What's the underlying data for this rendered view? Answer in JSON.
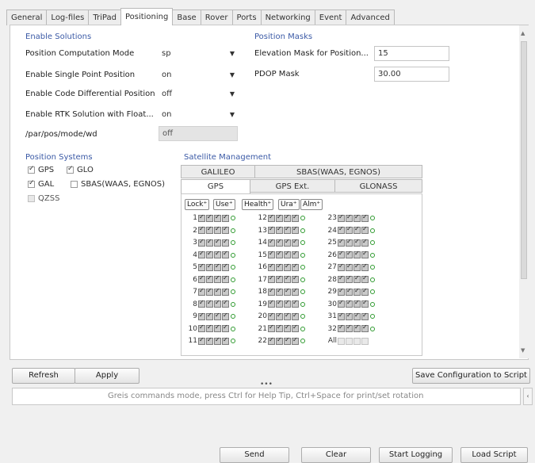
{
  "tabs": [
    "General",
    "Log-files",
    "TriPad",
    "Positioning",
    "Base",
    "Rover",
    "Ports",
    "Networking",
    "Event",
    "Advanced"
  ],
  "active_tab": "Positioning",
  "enable_solutions": {
    "title": "Enable Solutions",
    "rows": [
      {
        "label": "Position Computation Mode",
        "value": "sp"
      },
      {
        "label": "Enable Single Point Position",
        "value": "on"
      },
      {
        "label": "Enable Code Differential Position",
        "value": "off"
      },
      {
        "label": "Enable RTK Solution with Float...",
        "value": "on"
      }
    ],
    "wd_label": "/par/pos/mode/wd",
    "wd_value": "off"
  },
  "position_masks": {
    "title": "Position Masks",
    "elev_label": "Elevation Mask for Position...",
    "elev_value": "15",
    "pdop_label": "PDOP Mask",
    "pdop_value": "30.00"
  },
  "position_systems": {
    "title": "Position Systems",
    "gps": "GPS",
    "glo": "GLO",
    "gal": "GAL",
    "sbas": "SBAS(WAAS, EGNOS)",
    "qzss": "QZSS"
  },
  "sat_mgmt": {
    "title": "Satellite Management",
    "tabs_row1": [
      "GALILEO",
      "SBAS(WAAS, EGNOS)"
    ],
    "tabs_row2": [
      "GPS",
      "GPS Ext.",
      "GLONASS"
    ],
    "headers": [
      "Lock⁺",
      "Use⁺",
      "Health⁺",
      "Ura⁺",
      "Alm⁺"
    ],
    "all_label": "All"
  },
  "buttons": {
    "refresh": "Refresh",
    "apply": "Apply",
    "save": "Save Configuration to Script",
    "send": "Send",
    "clear": "Clear",
    "start_logging": "Start Logging",
    "load_script": "Load Script"
  },
  "console": {
    "splitter": "•••",
    "placeholder": "Greis commands mode, press Ctrl for Help Tip, Ctrl+Space for print/set rotation"
  }
}
